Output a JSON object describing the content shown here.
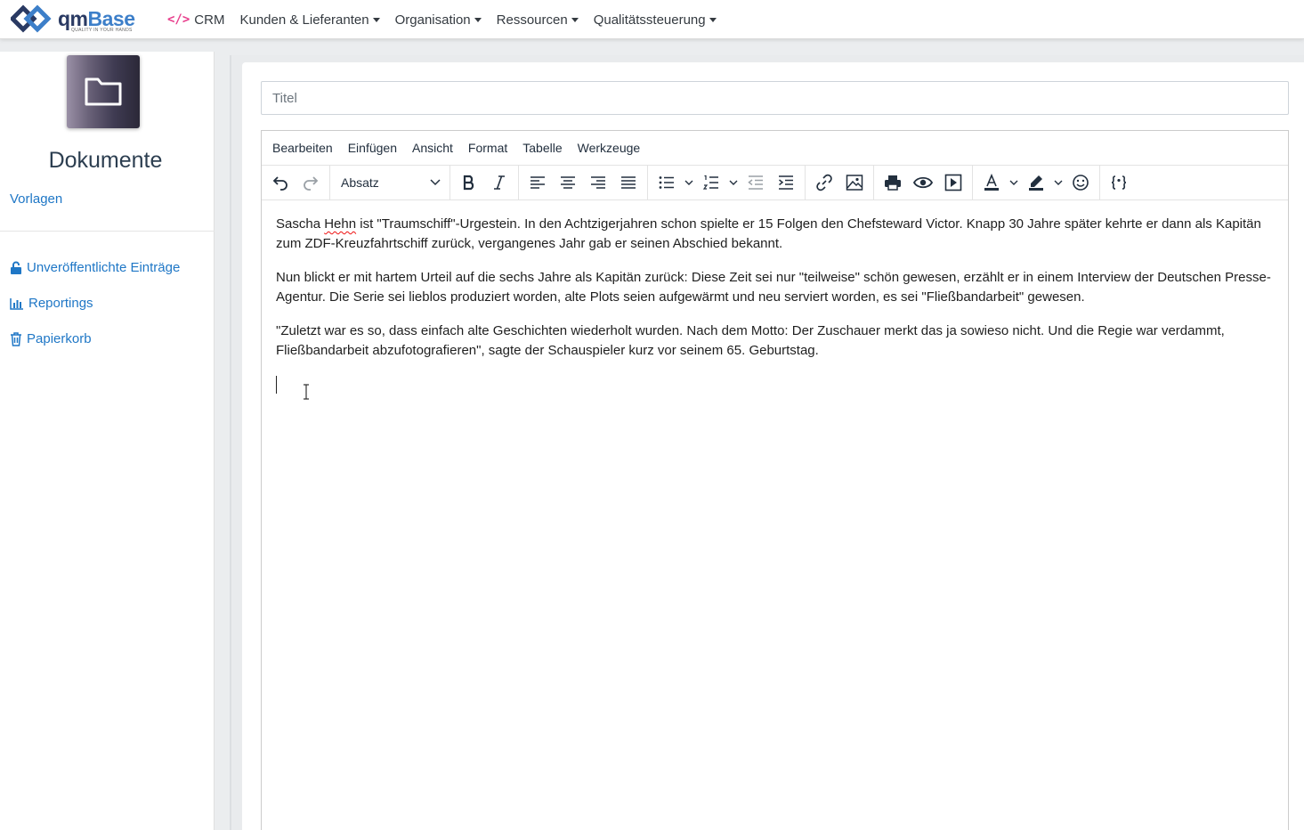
{
  "brand": {
    "name_part1": "qm",
    "name_part2": "Base",
    "tagline": "QUALITY IN YOUR HANDS",
    "color_dark": "#2a3a63",
    "color_accent": "#3d7fc9"
  },
  "nav": {
    "crm_icon": "</>",
    "items": [
      {
        "label": "CRM",
        "dropdown": false
      },
      {
        "label": "Kunden & Lieferanten",
        "dropdown": true
      },
      {
        "label": "Organisation",
        "dropdown": true
      },
      {
        "label": "Ressourcen",
        "dropdown": true
      },
      {
        "label": "Qualitätssteuerung",
        "dropdown": true
      }
    ]
  },
  "sidebar": {
    "tile_icon": "folder-icon",
    "title": "Dokumente",
    "templates_link": "Vorlagen",
    "links": [
      {
        "label": "Unveröffentlichte Einträge",
        "icon": "unlock-icon"
      },
      {
        "label": "Reportings",
        "icon": "bar-chart-icon"
      },
      {
        "label": "Papierkorb",
        "icon": "trash-icon"
      }
    ]
  },
  "editor": {
    "title_placeholder": "Titel",
    "title_value": "",
    "menu": [
      "Bearbeiten",
      "Einfügen",
      "Ansicht",
      "Format",
      "Tabelle",
      "Werkzeuge"
    ],
    "block_format": "Absatz",
    "paragraphs": [
      {
        "before": "Sascha ",
        "flagged": "Hehn",
        "after": " ist \"Traumschiff\"-Urgestein. In den Achtzigerjahren schon spielte er 15 Folgen den Chefsteward Victor. Knapp 30 Jahre später kehrte er dann als Kapitän zum ZDF-Kreuzfahrtschiff zurück, vergangenes Jahr gab er seinen Abschied bekannt."
      },
      {
        "text": "Nun blickt er mit hartem Urteil auf die sechs Jahre als Kapitän zurück: Diese Zeit sei nur \"teilweise\" schön gewesen, erzählt er in einem Interview der Deutschen Presse-Agentur. Die Serie sei lieblos produziert worden, alte Plots seien aufgewärmt und neu serviert worden, es sei \"Fließbandarbeit\" gewesen."
      },
      {
        "text": "\"Zuletzt war es so, dass einfach alte Geschichten wiederholt wurden. Nach dem Motto: Der Zuschauer merkt das ja sowieso nicht. Und die Regie war verdammt, Fließbandarbeit abzufotografieren\", sagte der Schauspieler kurz vor seinem 65. Geburtstag."
      }
    ]
  },
  "colors": {
    "link": "#1f77c6",
    "pink": "#e83e8c"
  }
}
